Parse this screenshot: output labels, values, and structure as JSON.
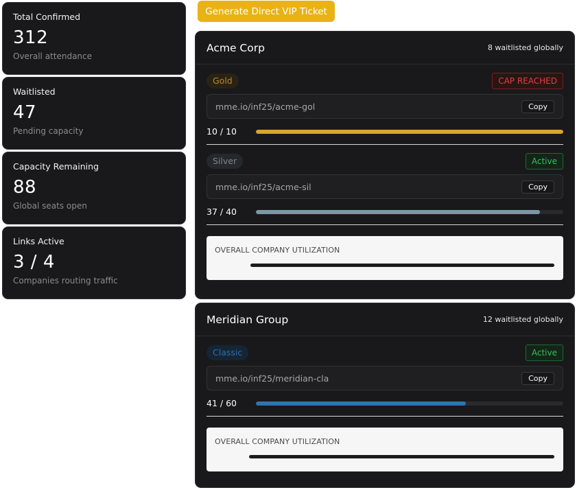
{
  "stats": [
    {
      "label": "Total Confirmed",
      "value": "312",
      "sub": "Overall attendance"
    },
    {
      "label": "Waitlisted",
      "value": "47",
      "sub": "Pending capacity"
    },
    {
      "label": "Capacity Remaining",
      "value": "88",
      "sub": "Global seats open"
    },
    {
      "label": "Links Active",
      "value": "3 / 4",
      "sub": "Companies routing traffic"
    }
  ],
  "vip_button_label": "Generate Direct VIP Ticket",
  "companies": [
    {
      "name": "Acme Corp",
      "waitlist": "8 waitlisted globally",
      "tiers": [
        {
          "tier": "Gold",
          "status": "CAP REACHED",
          "link": "mme.io/inf25/acme-gol",
          "copy": "Copy",
          "progress_text": "10 / 10",
          "fill_fraction": 1.0,
          "fill_color": "#d9a52a"
        },
        {
          "tier": "Silver",
          "status": "Active",
          "link": "mme.io/inf25/acme-sil",
          "copy": "Copy",
          "progress_text": "37 / 40",
          "fill_fraction": 0.925,
          "fill_color": "#7e97a8"
        }
      ],
      "utilization_label": "OVERALL COMPANY UTILIZATION"
    },
    {
      "name": "Meridian Group",
      "waitlist": "12 waitlisted globally",
      "tiers": [
        {
          "tier": "Classic",
          "status": "Active",
          "link": "mme.io/inf25/meridian-cla",
          "copy": "Copy",
          "progress_text": "41 / 60",
          "fill_fraction": 0.683,
          "fill_color": "#2c74b4"
        }
      ],
      "utilization_label": "OVERALL COMPANY UTILIZATION"
    }
  ]
}
